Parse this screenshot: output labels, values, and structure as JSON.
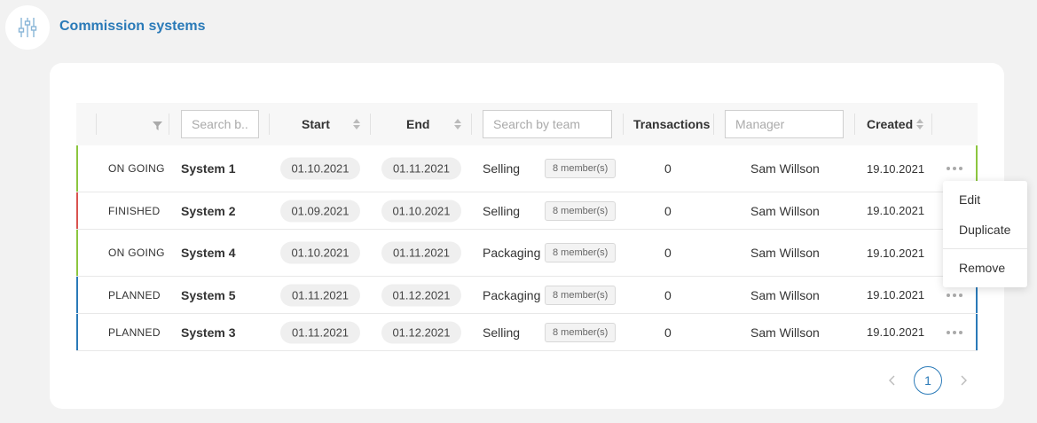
{
  "header": {
    "title": "Commission systems",
    "icon": "sliders-icon"
  },
  "table": {
    "columns": {
      "filter_icon": "filter-icon",
      "name_search_placeholder": "Search b...",
      "start": "Start",
      "end": "End",
      "team_search_placeholder": "Search by team",
      "transactions": "Transactions",
      "manager_placeholder": "Manager",
      "created": "Created"
    },
    "rows": [
      {
        "status": "ON GOING",
        "status_color": "#8cc63f",
        "name": "System 1",
        "start": "01.10.2021",
        "end": "01.11.2021",
        "team": "Selling",
        "members": "8 member(s)",
        "transactions": "0",
        "manager": "Sam Willson",
        "created": "19.10.2021"
      },
      {
        "status": "FINISHED",
        "status_color": "#d9534f",
        "name": "System 2",
        "start": "01.09.2021",
        "end": "01.10.2021",
        "team": "Selling",
        "members": "8 member(s)",
        "transactions": "0",
        "manager": "Sam Willson",
        "created": "19.10.2021"
      },
      {
        "status": "ON GOING",
        "status_color": "#8cc63f",
        "name": "System 4",
        "start": "01.10.2021",
        "end": "01.11.2021",
        "team": "Packaging",
        "members": "8 member(s)",
        "transactions": "0",
        "manager": "Sam Willson",
        "created": "19.10.2021"
      },
      {
        "status": "PLANNED",
        "status_color": "#2a7ab8",
        "name": "System 5",
        "start": "01.11.2021",
        "end": "01.12.2021",
        "team": "Packaging",
        "members": "8 member(s)",
        "transactions": "0",
        "manager": "Sam Willson",
        "created": "19.10.2021"
      },
      {
        "status": "PLANNED",
        "status_color": "#2a7ab8",
        "name": "System 3",
        "start": "01.11.2021",
        "end": "01.12.2021",
        "team": "Selling",
        "members": "8 member(s)",
        "transactions": "0",
        "manager": "Sam Willson",
        "created": "19.10.2021"
      }
    ]
  },
  "context_menu": {
    "edit": "Edit",
    "duplicate": "Duplicate",
    "remove": "Remove"
  },
  "pagination": {
    "current": "1"
  },
  "colors": {
    "accent": "#2a7ab8",
    "ongoing": "#8cc63f",
    "finished": "#d9534f",
    "planned": "#2a7ab8"
  }
}
